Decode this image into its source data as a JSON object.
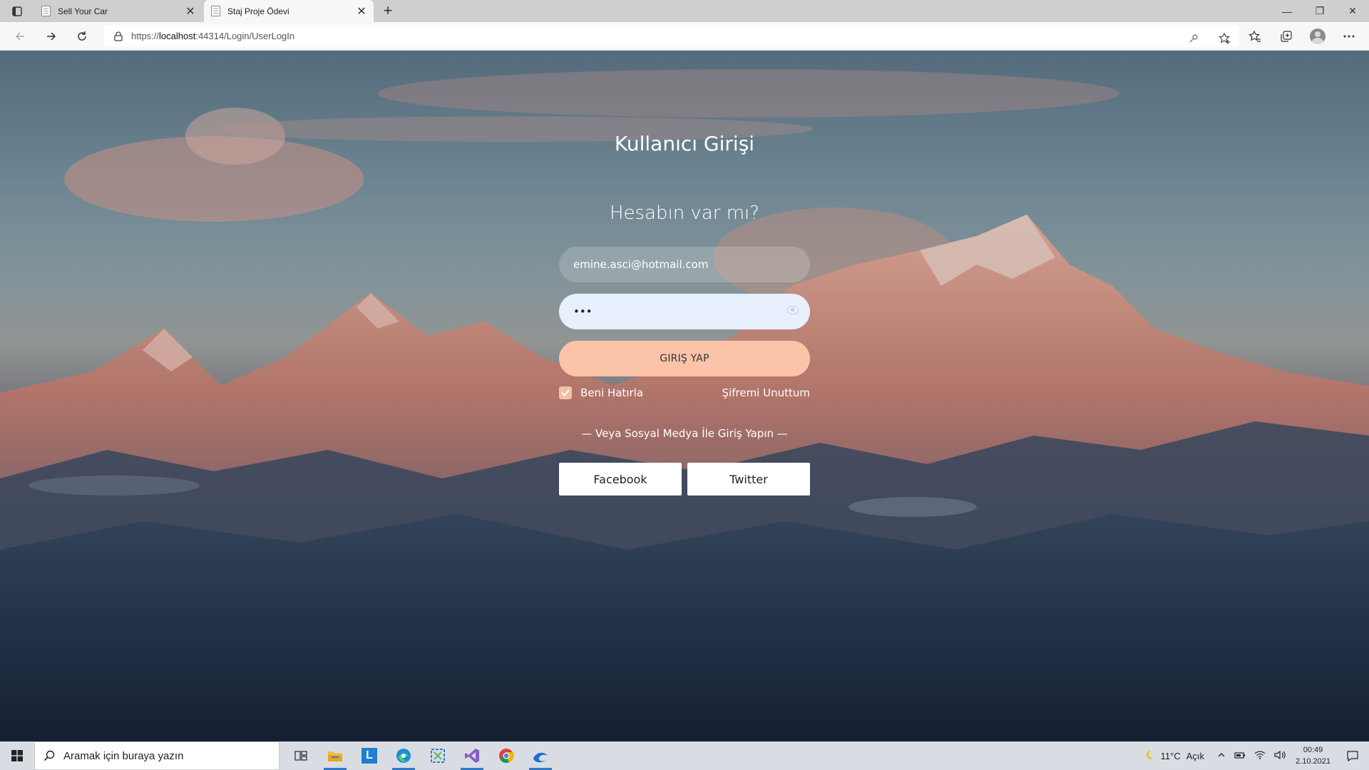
{
  "browser": {
    "tabs": [
      {
        "title": "Sell Your Car",
        "close": "✕",
        "active": false
      },
      {
        "title": "Staj Proje Ödevi",
        "close": "✕",
        "active": true
      }
    ],
    "new_tab": "+",
    "url_prefix": "https://",
    "url_host": "localhost",
    "url_rest": ":44314/Login/UserLogIn",
    "window_controls": {
      "minimize": "—",
      "restore": "❐",
      "close": "✕"
    }
  },
  "login": {
    "title": "Kullanıcı Girişi",
    "subtitle": "Hesabın var mı?",
    "email_value": "emine.asci@hotmail.com",
    "password_value": "•••",
    "submit_label": "GIRIŞ YAP",
    "remember_label": "Beni Hatırla",
    "remember_checked": true,
    "forgot_label": "Şifremi Unuttum",
    "social_text": "— Veya Sosyal Medya İle Giriş Yapın —",
    "facebook_label": "Facebook",
    "twitter_label": "Twitter",
    "accent_color": "#fbc4a9"
  },
  "taskbar": {
    "search_placeholder": "Aramak için buraya yazın",
    "apps": [
      "task-view",
      "file-explorer",
      "l-app",
      "edge",
      "snipping-tool",
      "visual-studio",
      "chrome",
      "dev-browser"
    ],
    "weather_temp": "11°C",
    "weather_desc": "Açık",
    "time": "00:49",
    "date": "2.10.2021"
  }
}
